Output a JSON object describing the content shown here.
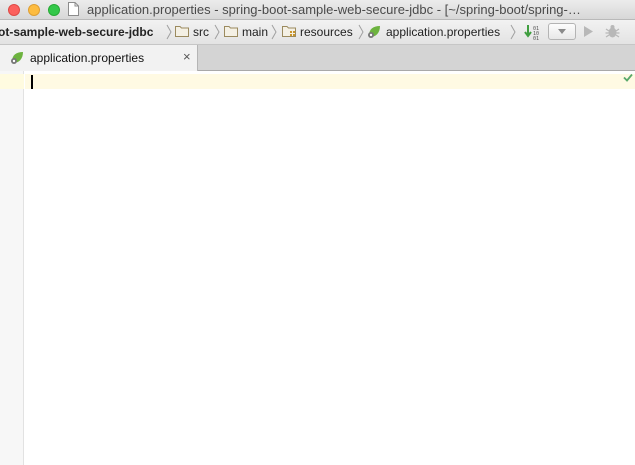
{
  "window": {
    "title": "application.properties - spring-boot-sample-web-secure-jdbc - [~/spring-boot/spring-…"
  },
  "breadcrumbs": [
    {
      "label": "ot-sample-web-secure-jdbc",
      "icon": "none"
    },
    {
      "label": "src",
      "icon": "folder-icon"
    },
    {
      "label": "main",
      "icon": "folder-icon"
    },
    {
      "label": "resources",
      "icon": "resources-folder-icon"
    },
    {
      "label": "application.properties",
      "icon": "spring-leaf-icon"
    }
  ],
  "toolbar": {
    "icons": [
      "build-binary-icon",
      "run-config-dropdown",
      "run-icon",
      "debug-icon"
    ]
  },
  "tabs": [
    {
      "label": "application.properties",
      "icon": "spring-leaf-icon",
      "active": true
    }
  ],
  "editor": {
    "content": "",
    "status_icon": "checkmark-icon"
  },
  "colors": {
    "spring_green": "#6db33f",
    "run_green": "#3f9e3f",
    "check_green": "#59a869",
    "current_line": "#fffae3"
  }
}
